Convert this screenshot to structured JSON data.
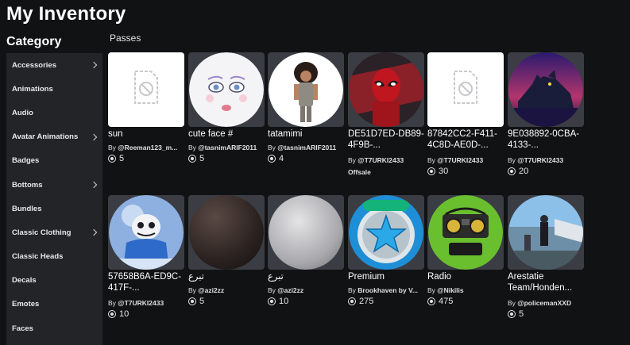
{
  "header": {
    "title": "My Inventory"
  },
  "sidebar": {
    "title": "Category",
    "items": [
      {
        "label": "Accessories",
        "has_chevron": true
      },
      {
        "label": "Animations",
        "has_chevron": false
      },
      {
        "label": "Audio",
        "has_chevron": false
      },
      {
        "label": "Avatar Animations",
        "has_chevron": true
      },
      {
        "label": "Badges",
        "has_chevron": false
      },
      {
        "label": "Bottoms",
        "has_chevron": true
      },
      {
        "label": "Bundles",
        "has_chevron": false
      },
      {
        "label": "Classic Clothing",
        "has_chevron": true
      },
      {
        "label": "Classic Heads",
        "has_chevron": false
      },
      {
        "label": "Decals",
        "has_chevron": false
      },
      {
        "label": "Emotes",
        "has_chevron": false
      },
      {
        "label": "Faces",
        "has_chevron": false
      }
    ]
  },
  "main": {
    "section_label": "Passes",
    "items": [
      {
        "name": "sun",
        "by_prefix": "By",
        "creator": "@Reeman123_m...",
        "price": "5",
        "thumb": "placeholder-icon"
      },
      {
        "name": "cute face #",
        "by_prefix": "By",
        "creator": "@tasnimARIF2011",
        "price": "5",
        "thumb": "face-image"
      },
      {
        "name": "tatamimi",
        "by_prefix": "By",
        "creator": "@tasnimARIF2011",
        "price": "4",
        "thumb": "avatar-image"
      },
      {
        "name": "DE51D7ED-DB89-4F9B-...",
        "by_prefix": "By",
        "creator": "@T7URKI2433",
        "status": "Offsale",
        "thumb": "deadpool-image"
      },
      {
        "name": "87842CC2-F411-4C8D-AE0D-...",
        "by_prefix": "By",
        "creator": "@T7URKI2433",
        "price": "30",
        "thumb": "placeholder-icon"
      },
      {
        "name": "9E038892-0CBA-4133-...",
        "by_prefix": "By",
        "creator": "@T7URKI2433",
        "price": "20",
        "thumb": "wolf-image"
      },
      {
        "name": "57658B6A-ED9C-417F-...",
        "by_prefix": "By",
        "creator": "@T7URKI2433",
        "price": "10",
        "thumb": "sans-image"
      },
      {
        "name": "تبرع",
        "by_prefix": "By",
        "creator": "@azi2zz",
        "price": "5",
        "thumb": "dark-sphere-image"
      },
      {
        "name": "تبرع",
        "by_prefix": "By",
        "creator": "@azi2zz",
        "price": "10",
        "thumb": "grey-sphere-image"
      },
      {
        "name": "Premium",
        "by_prefix": "By",
        "creator": "Brookhaven by V...",
        "price": "275",
        "thumb": "premium-star-image"
      },
      {
        "name": "Radio",
        "by_prefix": "By",
        "creator": "@Nikilis",
        "price": "475",
        "thumb": "radio-image"
      },
      {
        "name": "Arestatie Team/Honden...",
        "by_prefix": "By",
        "creator": "@policemanXXD",
        "price": "5",
        "thumb": "police-scene-image"
      }
    ]
  },
  "colors": {
    "background": "#111214",
    "sidebar": "#232428",
    "card_bg": "#3b3d44"
  }
}
